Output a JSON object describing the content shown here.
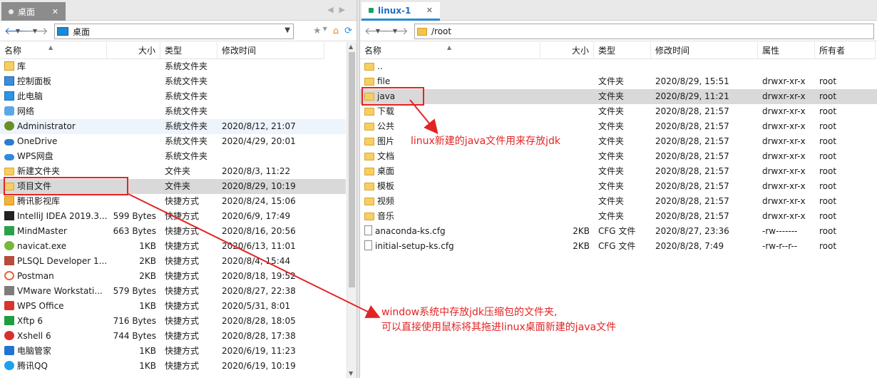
{
  "left": {
    "tab": {
      "label": "桌面"
    },
    "address": "桌面",
    "columns": [
      "名称",
      "大小",
      "类型",
      "修改时间"
    ],
    "rows": [
      {
        "icon": "library-icon",
        "name": "库",
        "size": "",
        "type": "系统文件夹",
        "date": ""
      },
      {
        "icon": "control-panel-icon",
        "name": "控制面板",
        "size": "",
        "type": "系统文件夹",
        "date": ""
      },
      {
        "icon": "computer-icon",
        "name": "此电脑",
        "size": "",
        "type": "系统文件夹",
        "date": ""
      },
      {
        "icon": "network-icon",
        "name": "网络",
        "size": "",
        "type": "系统文件夹",
        "date": ""
      },
      {
        "icon": "user-icon",
        "name": "Administrator",
        "size": "",
        "type": "系统文件夹",
        "date": "2020/8/12, 21:07"
      },
      {
        "icon": "onedrive-icon",
        "name": "OneDrive",
        "size": "",
        "type": "系统文件夹",
        "date": "2020/4/29, 20:01"
      },
      {
        "icon": "wps-cloud-icon",
        "name": "WPS网盘",
        "size": "",
        "type": "系统文件夹",
        "date": ""
      },
      {
        "icon": "folder-icon",
        "name": "新建文件夹",
        "size": "",
        "type": "文件夹",
        "date": "2020/8/3, 11:22"
      },
      {
        "icon": "folder-icon",
        "name": "项目文件",
        "size": "",
        "type": "文件夹",
        "date": "2020/8/29, 10:19"
      },
      {
        "icon": "tencent-video-icon",
        "name": "腾讯影视库",
        "size": "",
        "type": "快捷方式",
        "date": "2020/8/24, 15:06"
      },
      {
        "icon": "intellij-icon",
        "name": "IntelliJ IDEA 2019.3....",
        "size": "599 Bytes",
        "type": "快捷方式",
        "date": "2020/6/9, 17:49"
      },
      {
        "icon": "mindmaster-icon",
        "name": "MindMaster",
        "size": "663 Bytes",
        "type": "快捷方式",
        "date": "2020/8/16, 20:56"
      },
      {
        "icon": "navicat-icon",
        "name": "navicat.exe",
        "size": "1KB",
        "type": "快捷方式",
        "date": "2020/6/13, 11:01"
      },
      {
        "icon": "plsql-icon",
        "name": "PLSQL Developer 1...",
        "size": "2KB",
        "type": "快捷方式",
        "date": "2020/8/4, 15:44"
      },
      {
        "icon": "postman-icon",
        "name": "Postman",
        "size": "2KB",
        "type": "快捷方式",
        "date": "2020/8/18, 19:52"
      },
      {
        "icon": "vmware-icon",
        "name": "VMware Workstati...",
        "size": "579 Bytes",
        "type": "快捷方式",
        "date": "2020/8/27, 22:38"
      },
      {
        "icon": "wps-office-icon",
        "name": "WPS Office",
        "size": "1KB",
        "type": "快捷方式",
        "date": "2020/5/31, 8:01"
      },
      {
        "icon": "xftp-icon",
        "name": "Xftp 6",
        "size": "716 Bytes",
        "type": "快捷方式",
        "date": "2020/8/28, 18:05"
      },
      {
        "icon": "xshell-icon",
        "name": "Xshell 6",
        "size": "744 Bytes",
        "type": "快捷方式",
        "date": "2020/8/28, 17:38"
      },
      {
        "icon": "pc-manager-icon",
        "name": "电脑管家",
        "size": "1KB",
        "type": "快捷方式",
        "date": "2020/6/19, 11:23"
      },
      {
        "icon": "qq-icon",
        "name": "腾讯QQ",
        "size": "1KB",
        "type": "快捷方式",
        "date": "2020/6/19, 10:19"
      }
    ]
  },
  "right": {
    "tab": {
      "label": "linux-1"
    },
    "address": "/root",
    "columns": [
      "名称",
      "大小",
      "类型",
      "修改时间",
      "属性",
      "所有者"
    ],
    "rows": [
      {
        "icon": "folder-icon",
        "name": "..",
        "size": "",
        "type": "",
        "date": "",
        "attr": "",
        "owner": ""
      },
      {
        "icon": "folder-icon",
        "name": "file",
        "size": "",
        "type": "文件夹",
        "date": "2020/8/29, 15:51",
        "attr": "drwxr-xr-x",
        "owner": "root"
      },
      {
        "icon": "folder-icon",
        "name": "java",
        "size": "",
        "type": "文件夹",
        "date": "2020/8/29, 11:21",
        "attr": "drwxr-xr-x",
        "owner": "root"
      },
      {
        "icon": "folder-icon",
        "name": "下载",
        "size": "",
        "type": "文件夹",
        "date": "2020/8/28, 21:57",
        "attr": "drwxr-xr-x",
        "owner": "root"
      },
      {
        "icon": "folder-icon",
        "name": "公共",
        "size": "",
        "type": "文件夹",
        "date": "2020/8/28, 21:57",
        "attr": "drwxr-xr-x",
        "owner": "root"
      },
      {
        "icon": "folder-icon",
        "name": "图片",
        "size": "",
        "type": "文件夹",
        "date": "2020/8/28, 21:57",
        "attr": "drwxr-xr-x",
        "owner": "root"
      },
      {
        "icon": "folder-icon",
        "name": "文档",
        "size": "",
        "type": "文件夹",
        "date": "2020/8/28, 21:57",
        "attr": "drwxr-xr-x",
        "owner": "root"
      },
      {
        "icon": "folder-icon",
        "name": "桌面",
        "size": "",
        "type": "文件夹",
        "date": "2020/8/28, 21:57",
        "attr": "drwxr-xr-x",
        "owner": "root"
      },
      {
        "icon": "folder-icon",
        "name": "模板",
        "size": "",
        "type": "文件夹",
        "date": "2020/8/28, 21:57",
        "attr": "drwxr-xr-x",
        "owner": "root"
      },
      {
        "icon": "folder-icon",
        "name": "视频",
        "size": "",
        "type": "文件夹",
        "date": "2020/8/28, 21:57",
        "attr": "drwxr-xr-x",
        "owner": "root"
      },
      {
        "icon": "folder-icon",
        "name": "音乐",
        "size": "",
        "type": "文件夹",
        "date": "2020/8/28, 21:57",
        "attr": "drwxr-xr-x",
        "owner": "root"
      },
      {
        "icon": "file-icon",
        "name": "anaconda-ks.cfg",
        "size": "2KB",
        "type": "CFG 文件",
        "date": "2020/8/27, 23:36",
        "attr": "-rw-------",
        "owner": "root"
      },
      {
        "icon": "file-icon",
        "name": "initial-setup-ks.cfg",
        "size": "2KB",
        "type": "CFG 文件",
        "date": "2020/8/28, 7:49",
        "attr": "-rw-r--r--",
        "owner": "root"
      }
    ]
  },
  "annotations": {
    "java_note": "linux新建的java文件用来存放jdk",
    "window_note_line1": "window系统中存放jdk压缩包的文件夹,",
    "window_note_line2": "可以直接使用鼠标将其拖进linux桌面新建的java文件"
  },
  "colors": {
    "annotation": "#e32424",
    "selected_row": "#d9d9d9",
    "right_tab_text": "#1b6fc2"
  }
}
